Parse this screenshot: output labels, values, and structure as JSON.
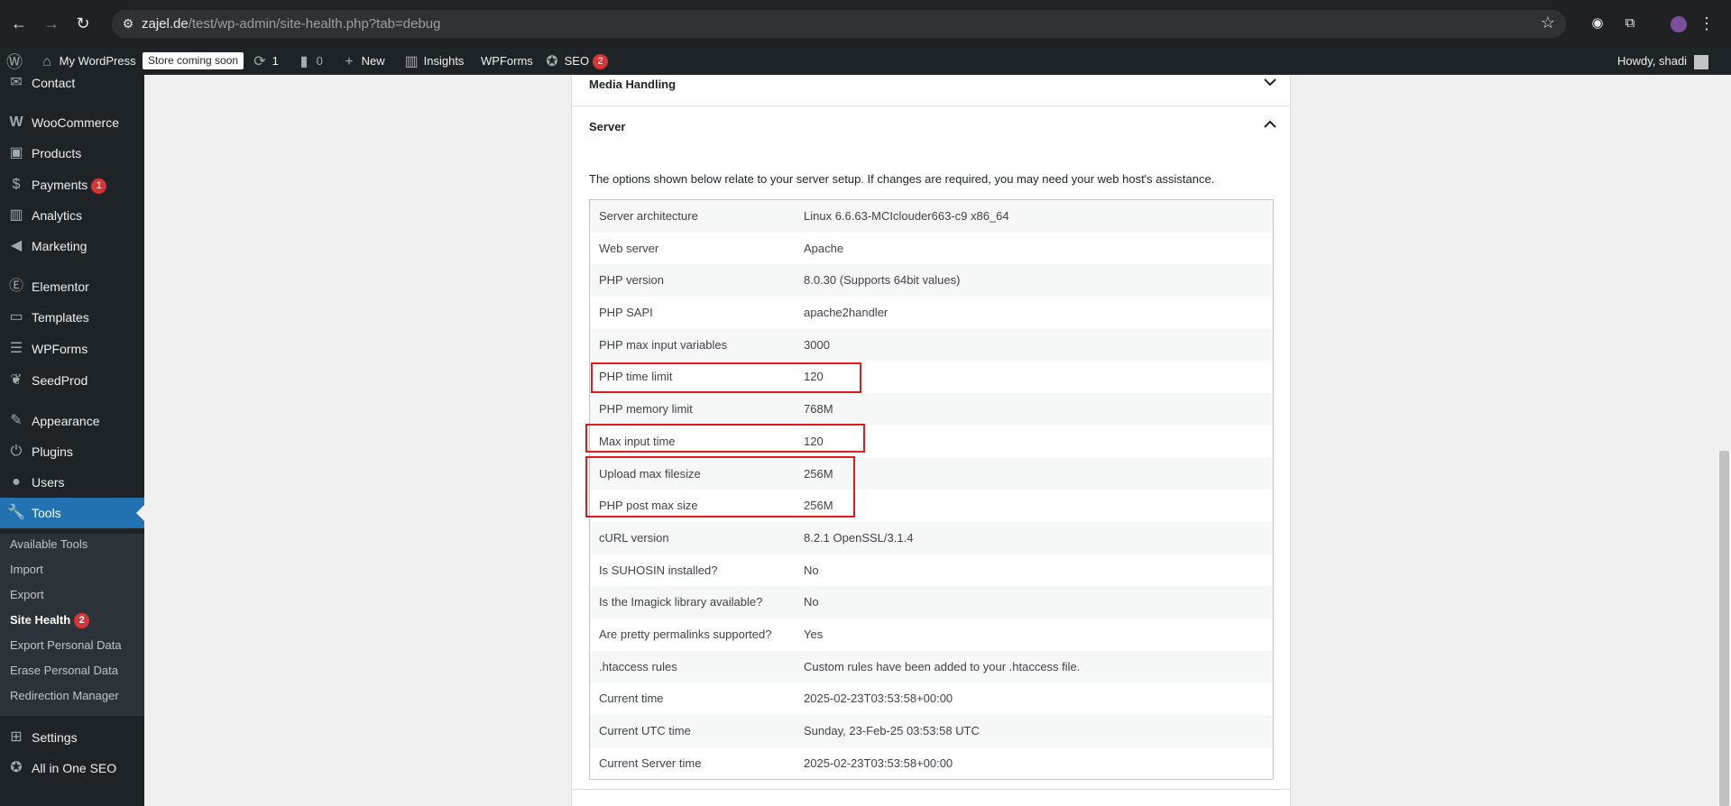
{
  "browser": {
    "url_host": "zajel.de",
    "url_path": "/test/wp-admin/site-health.php?tab=debug"
  },
  "adminbar": {
    "site_name": "My WordPress",
    "store_badge": "Store coming soon",
    "updates_count": "1",
    "comments_count": "0",
    "new_label": "New",
    "insights_label": "Insights",
    "wpforms_label": "WPForms",
    "seo_label": "SEO",
    "seo_count": "2",
    "howdy": "Howdy, shadi"
  },
  "sidebar": {
    "items": [
      {
        "label": "Contact",
        "icon": "envelope-icon"
      },
      {
        "label": "WooCommerce",
        "icon": "woocommerce-icon"
      },
      {
        "label": "Products",
        "icon": "archive-icon"
      },
      {
        "label": "Payments",
        "icon": "dollar-icon",
        "count": "1"
      },
      {
        "label": "Analytics",
        "icon": "bar-chart-icon"
      },
      {
        "label": "Marketing",
        "icon": "megaphone-icon"
      },
      {
        "label": "Elementor",
        "icon": "elementor-icon"
      },
      {
        "label": "Templates",
        "icon": "folder-icon"
      },
      {
        "label": "WPForms",
        "icon": "forms-icon"
      },
      {
        "label": "SeedProd",
        "icon": "seedprod-icon"
      },
      {
        "label": "Appearance",
        "icon": "brush-icon"
      },
      {
        "label": "Plugins",
        "icon": "plug-icon"
      },
      {
        "label": "Users",
        "icon": "user-icon"
      },
      {
        "label": "Tools",
        "icon": "wrench-icon"
      },
      {
        "label": "Settings",
        "icon": "settings-icon"
      },
      {
        "label": "All in One SEO",
        "icon": "aioseo-icon"
      }
    ],
    "submenu": [
      {
        "label": "Available Tools"
      },
      {
        "label": "Import"
      },
      {
        "label": "Export"
      },
      {
        "label": "Site Health",
        "count": "2"
      },
      {
        "label": "Export Personal Data"
      },
      {
        "label": "Erase Personal Data"
      },
      {
        "label": "Redirection Manager"
      }
    ]
  },
  "sections": {
    "media_title": "Media Handling",
    "server_title": "Server",
    "server_desc": "The options shown below relate to your server setup. If changes are required, you may need your web host's assistance."
  },
  "server_rows": [
    {
      "key": "Server architecture",
      "value": "Linux 6.6.63-MCIclouder663-c9 x86_64"
    },
    {
      "key": "Web server",
      "value": "Apache"
    },
    {
      "key": "PHP version",
      "value": "8.0.30 (Supports 64bit values)"
    },
    {
      "key": "PHP SAPI",
      "value": "apache2handler"
    },
    {
      "key": "PHP max input variables",
      "value": "3000"
    },
    {
      "key": "PHP time limit",
      "value": "120"
    },
    {
      "key": "PHP memory limit",
      "value": "768M"
    },
    {
      "key": "Max input time",
      "value": "120"
    },
    {
      "key": "Upload max filesize",
      "value": "256M"
    },
    {
      "key": "PHP post max size",
      "value": "256M"
    },
    {
      "key": "cURL version",
      "value": "8.2.1 OpenSSL/3.1.4"
    },
    {
      "key": "Is SUHOSIN installed?",
      "value": "No"
    },
    {
      "key": "Is the Imagick library available?",
      "value": "No"
    },
    {
      "key": "Are pretty permalinks supported?",
      "value": "Yes"
    },
    {
      "key": ".htaccess rules",
      "value": "Custom rules have been added to your .htaccess file."
    },
    {
      "key": "Current time",
      "value": "2025-02-23T03:53:58+00:00"
    },
    {
      "key": "Current UTC time",
      "value": "Sunday, 23-Feb-25 03:53:58 UTC"
    },
    {
      "key": "Current Server time",
      "value": "2025-02-23T03:53:58+00:00"
    }
  ],
  "colors": {
    "admin_dark": "#1d2327",
    "accent_blue": "#2271b1",
    "highlight_red": "#e21b1b",
    "badge_red": "#d63638"
  }
}
